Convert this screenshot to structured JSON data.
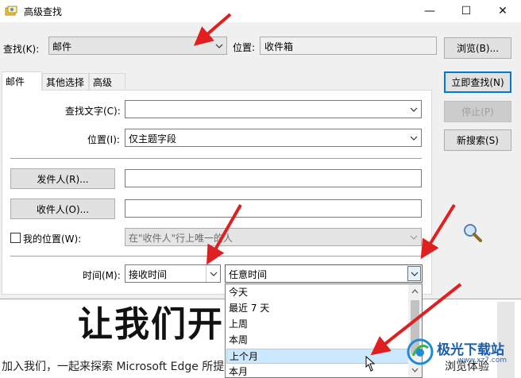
{
  "background": {
    "heading": "让我们开",
    "line_left": "加入我们，一起来探索 Microsoft Edge 所提",
    "line_right": "浏览体验"
  },
  "dialog": {
    "title": "高级查找",
    "window": {
      "minimize": "—",
      "maximize": "☐",
      "close": "✕"
    },
    "lookfor_label": "查找(K):",
    "lookfor_value": "邮件",
    "location_label": "位置:",
    "location_value": "收件箱",
    "browse_button": "浏览(B)...",
    "find_now_button": "立即查找(N)",
    "stop_button": "停止(P)",
    "new_search_button": "新搜索(S)",
    "tabs": [
      "邮件",
      "其他选择",
      "高级"
    ],
    "search_text_label": "查找文字(C):",
    "search_text_value": "",
    "in_label": "位置(I):",
    "in_value": "仅主题字段",
    "from_button": "发件人(R)...",
    "from_value": "",
    "sent_to_button": "收件人(O)...",
    "sent_to_value": "",
    "where_label": "我的位置(W):",
    "where_value": "在\"收件人\"行上唯一的人",
    "time_label": "时间(M):",
    "time_field_value": "接收时间",
    "time_range_value": "任意时间",
    "time_range_options": [
      "今天",
      "最近 7 天",
      "上周",
      "本周",
      "上个月",
      "本月"
    ],
    "selected_option_index": 4
  },
  "watermark": {
    "brand": "极光下载站",
    "site": "www.xz7.com"
  },
  "colors": {
    "accent": "#0078d7",
    "annotation": "#e02020"
  }
}
